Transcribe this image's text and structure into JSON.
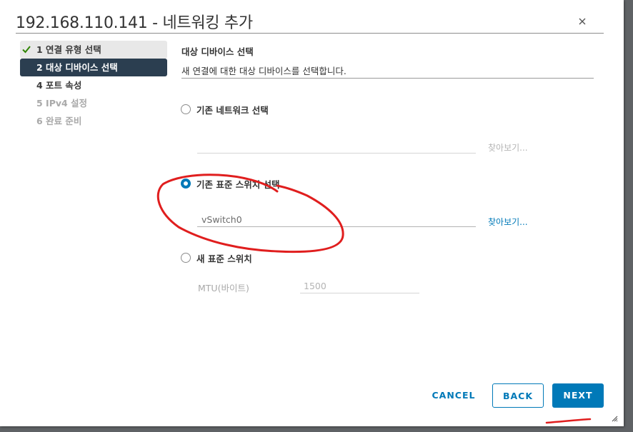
{
  "dialog": {
    "title": "192.168.110.141 - 네트워킹 추가",
    "close_icon": "close-icon"
  },
  "steps": [
    {
      "label": "1 연결 유형 선택",
      "state": "done"
    },
    {
      "label": "2 대상 디바이스 선택",
      "state": "active"
    },
    {
      "label": "4 포트 속성",
      "state": "enabled"
    },
    {
      "label": "5 IPv4 설정",
      "state": "disabled"
    },
    {
      "label": "6 완료 준비",
      "state": "disabled"
    }
  ],
  "section": {
    "title": "대상 디바이스 선택",
    "description": "새 연결에 대한 대상 디바이스를 선택합니다."
  },
  "options": {
    "existing_network": {
      "label": "기존 네트워크 선택",
      "selected": false,
      "value": "",
      "browse_label": "찾아보기..."
    },
    "existing_switch": {
      "label": "기존 표준 스위치 선택",
      "selected": true,
      "value": "vSwitch0",
      "browse_label": "찾아보기..."
    },
    "new_switch": {
      "label": "새 표준 스위치",
      "selected": false,
      "mtu_label": "MTU(바이트)",
      "mtu_value": "1500"
    }
  },
  "buttons": {
    "cancel": "CANCEL",
    "back": "BACK",
    "next": "NEXT"
  },
  "colors": {
    "accent": "#0079b8",
    "active_step_bg": "#2b3e50",
    "annotation": "#e01e1e",
    "check": "#2f8400"
  }
}
